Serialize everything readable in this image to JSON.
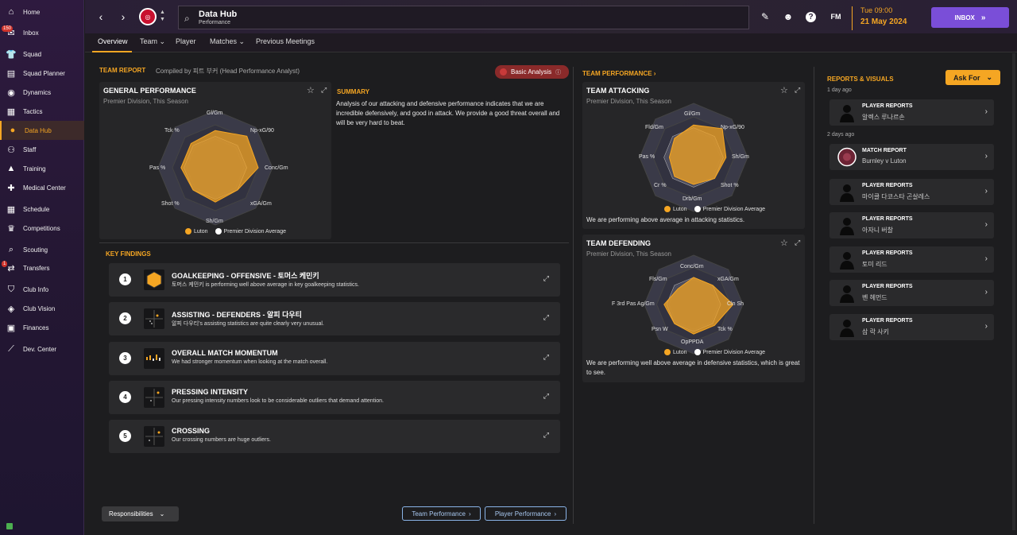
{
  "sidebar": {
    "items": [
      {
        "label": "Home",
        "icon": "home-icon",
        "glyph": "⌂"
      },
      {
        "label": "Inbox",
        "icon": "inbox-icon",
        "glyph": "✉",
        "badge": "150"
      },
      {
        "label": "Squad",
        "icon": "shirt-icon",
        "glyph": "👕"
      },
      {
        "label": "Squad Planner",
        "icon": "planner-icon",
        "glyph": "▤"
      },
      {
        "label": "Dynamics",
        "icon": "dynamics-icon",
        "glyph": "◉"
      },
      {
        "label": "Tactics",
        "icon": "tactics-icon",
        "glyph": "▦"
      },
      {
        "label": "Data Hub",
        "icon": "data-hub-icon",
        "glyph": "●",
        "active": true
      },
      {
        "label": "Staff",
        "icon": "staff-icon",
        "glyph": "⚇"
      },
      {
        "label": "Training",
        "icon": "training-icon",
        "glyph": "▲"
      },
      {
        "label": "Medical Center",
        "icon": "medical-icon",
        "glyph": "✚"
      },
      {
        "label": "Schedule",
        "icon": "calendar-icon",
        "glyph": "▦"
      },
      {
        "label": "Competitions",
        "icon": "trophy-icon",
        "glyph": "♛"
      },
      {
        "label": "Scouting",
        "icon": "scouting-icon",
        "glyph": "⌕"
      },
      {
        "label": "Transfers",
        "icon": "transfers-icon",
        "glyph": "⇄",
        "badge": "1"
      },
      {
        "label": "Club Info",
        "icon": "shield-icon",
        "glyph": "⛉"
      },
      {
        "label": "Club Vision",
        "icon": "vision-icon",
        "glyph": "◈"
      },
      {
        "label": "Finances",
        "icon": "finances-icon",
        "glyph": "▣"
      },
      {
        "label": "Dev. Center",
        "icon": "dev-center-icon",
        "glyph": "⟋"
      }
    ]
  },
  "header": {
    "title": "Data Hub",
    "subtitle": "Performance",
    "fm_label": "FM",
    "time": "Tue 09:00",
    "date": "21 May 2024",
    "inbox_label": "INBOX"
  },
  "tabs": [
    {
      "label": "Overview"
    },
    {
      "label": "Team ⌄"
    },
    {
      "label": "Player"
    },
    {
      "label": "Matches ⌄"
    },
    {
      "label": "Previous Meetings"
    }
  ],
  "team_report": {
    "title": "TEAM REPORT",
    "compiled_by": "Compiled by 피트 부커 (Head Performance Analyst)",
    "basic_analysis": "Basic Analysis",
    "general": {
      "title": "GENERAL PERFORMANCE",
      "sub": "Premier Division, This Season",
      "labels": [
        "Gl/Gm",
        "Np-xG/90",
        "Conc/Gm",
        "xGA/Gm",
        "Sh/Gm",
        "Shot %",
        "Pas %",
        "Tck %"
      ]
    },
    "summary_title": "SUMMARY",
    "summary_text": "Analysis of our attacking and defensive performance indicates that we are incredible defensively, and good in attack. We provide a good threat overall and will be very hard to beat.",
    "legend_team": "Luton",
    "legend_avg": "Premier Division Average",
    "key_findings_title": "KEY FINDINGS",
    "findings": [
      {
        "num": "1",
        "title": "GOALKEEPING - OFFENSIVE - 토머스 케민키",
        "text": "토머스 케민키 is performing well above average in key goalkeeping statistics."
      },
      {
        "num": "2",
        "title": "ASSISTING - DEFENDERS - 알피 다우티",
        "text": "알피 다우티's assisting statistics are quite clearly very unusual."
      },
      {
        "num": "3",
        "title": "OVERALL MATCH MOMENTUM",
        "text": "We had stronger momentum when looking at the match overall."
      },
      {
        "num": "4",
        "title": "PRESSING INTENSITY",
        "text": "Our pressing intensity numbers look to be considerable outliers that demand attention."
      },
      {
        "num": "5",
        "title": "CROSSING",
        "text": "Our crossing numbers are huge outliers."
      }
    ],
    "responsibilities": "Responsibilities",
    "team_performance_btn": "Team Performance",
    "player_performance_btn": "Player Performance"
  },
  "team_performance": {
    "title": "TEAM PERFORMANCE",
    "attacking": {
      "title": "TEAM ATTACKING",
      "sub": "Premier Division, This Season",
      "labels": [
        "Gl/Gm",
        "Np-xG/90",
        "Sh/Gm",
        "Shot %",
        "Drb/Gm",
        "Cr %",
        "Pas %",
        "Fld/Gm"
      ],
      "text": "We are performing above average in attacking statistics."
    },
    "defending": {
      "title": "TEAM DEFENDING",
      "sub": "Premier Division, This Season",
      "labels": [
        "Conc/Gm",
        "xGA/Gm",
        "Cln Sh",
        "Tck %",
        "OpPPDA",
        "Psn W",
        "F 3rd Pas Ag/Gm",
        "Fls/Gm"
      ],
      "text": "We are performing well above average in defensive statistics, which is great to see."
    }
  },
  "reports": {
    "title": "REPORTS & VISUALS",
    "ask_for": "Ask For",
    "groups": [
      {
        "when": "1 day ago"
      },
      {
        "when": "2 days ago"
      }
    ],
    "items": [
      {
        "title": "PLAYER REPORTS",
        "sub": "알렉스 루나르손"
      },
      {
        "title": "MATCH REPORT",
        "sub": "Burnley v Luton"
      },
      {
        "title": "PLAYER REPORTS",
        "sub": "마이클 다코스타 곤살레스"
      },
      {
        "title": "PLAYER REPORTS",
        "sub": "아자니 버찰"
      },
      {
        "title": "PLAYER REPORTS",
        "sub": "토미 리드"
      },
      {
        "title": "PLAYER REPORTS",
        "sub": "벤 헤먼드"
      },
      {
        "title": "PLAYER REPORTS",
        "sub": "삼 락 사키"
      }
    ]
  },
  "colors": {
    "accent": "#f5a623",
    "inbox": "#7a4ed8",
    "team": "#f5a623",
    "avg": "#ffffff"
  }
}
